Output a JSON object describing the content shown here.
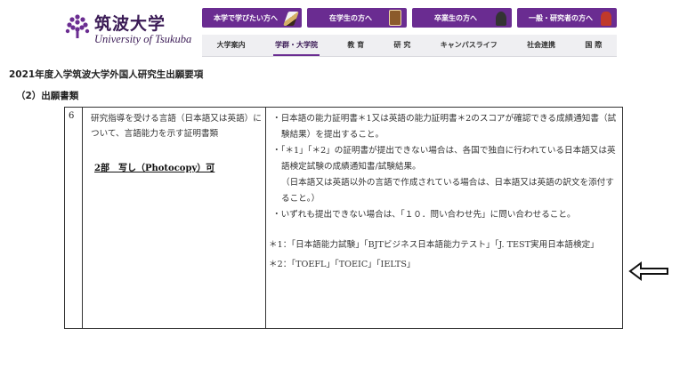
{
  "header": {
    "logo_jp": "筑波大学",
    "logo_en": "University of Tsukuba",
    "top_nav": [
      {
        "label": "本学で学びたい方へ",
        "icon": "pencil-icon"
      },
      {
        "label": "在学生の方へ",
        "icon": "book-icon"
      },
      {
        "label": "卒業生の方へ",
        "icon": "graduate-icon"
      },
      {
        "label": "一般・研究者の方へ",
        "icon": "person-icon"
      }
    ],
    "sub_nav": [
      {
        "label": "大学案内",
        "active": false
      },
      {
        "label": "学群・大学院",
        "active": true
      },
      {
        "label": "教 育",
        "active": false
      },
      {
        "label": "研 究",
        "active": false
      },
      {
        "label": "キャンパスライフ",
        "active": false
      },
      {
        "label": "社会連携",
        "active": false
      },
      {
        "label": "国 際",
        "active": false
      }
    ],
    "accent_color": "#6a2c91"
  },
  "document": {
    "title": "2021年度入学筑波大学外国人研究生出願要項",
    "section": "（2）出願書類",
    "row": {
      "number": "6",
      "requirement": "研究指導を受ける言語（日本語又は英語）について、言語能力を示す証明書類",
      "copies": "2部　写し（Photocopy）可",
      "notes": [
        "・日本語の能力証明書＊1又は英語の能力証明書＊2のスコアが確認できる成績通知書（試験結果）を提出すること。",
        "・「＊1」「＊2」の証明書が提出できない場合は、各国で独自に行われている日本語又は英語検定試験の成績通知書/試験結果。",
        "（日本語又は英語以外の言語で作成されている場合は、日本語又は英語の訳文を添付すること。）",
        "・いずれも提出できない場合は、「１０．問い合わせ先」に問い合わせること。"
      ],
      "footnote1": "＊1：「日本語能力試験」「BJTビジネス日本語能力テスト」「J. TEST実用日本語検定」",
      "footnote2": "＊2：「TOEFL」「TOEIC」「IELTS」"
    }
  },
  "annotation": {
    "icon": "left-arrow-icon"
  }
}
